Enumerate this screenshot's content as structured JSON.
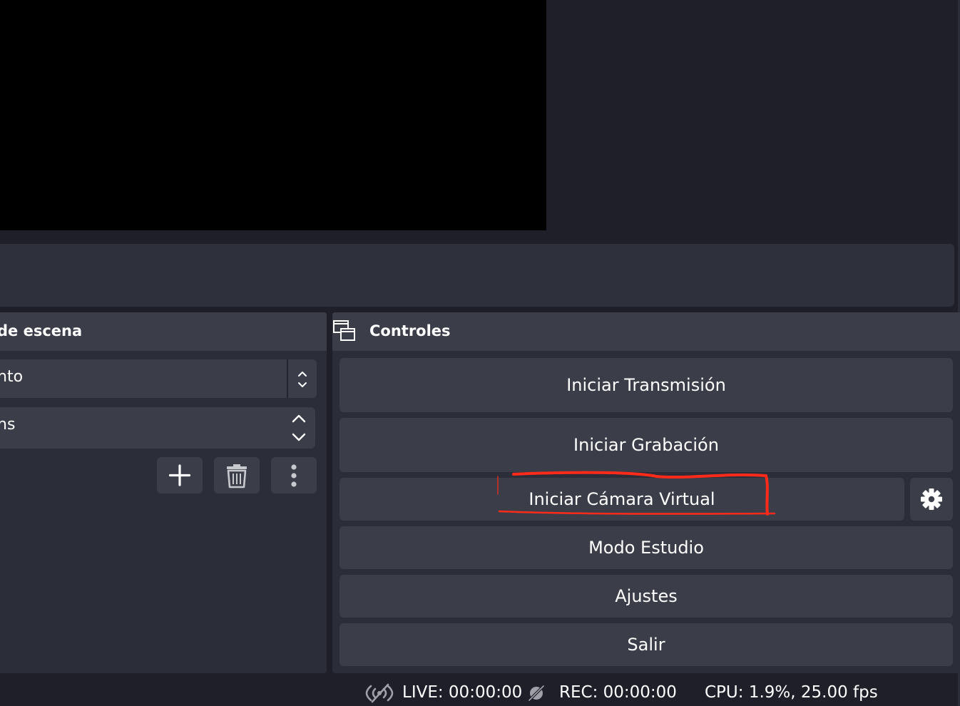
{
  "scene_transitions": {
    "title": "de escena",
    "transition_value": "nto",
    "duration_value": "ns",
    "add_icon": "plus-icon",
    "remove_icon": "trash-icon",
    "more_icon": "vertical-dots-icon"
  },
  "controls": {
    "title": "Controles",
    "float_icon": "undock-icon",
    "start_streaming": "Iniciar Transmisión",
    "start_recording": "Iniciar Grabación",
    "start_virtual_camera": "Iniciar Cámara Virtual",
    "virtual_camera_settings_icon": "gear-icon",
    "studio_mode": "Modo Estudio",
    "settings": "Ajustes",
    "exit": "Salir"
  },
  "status_bar": {
    "live": "LIVE: 00:00:00",
    "rec": "REC: 00:00:00",
    "cpu": "CPU: 1.9%, 25.00 fps"
  },
  "colors": {
    "background": "#1e1f29",
    "panel": "#2b2d38",
    "button": "#3b3d49",
    "annotation": "#ff2a1a"
  }
}
